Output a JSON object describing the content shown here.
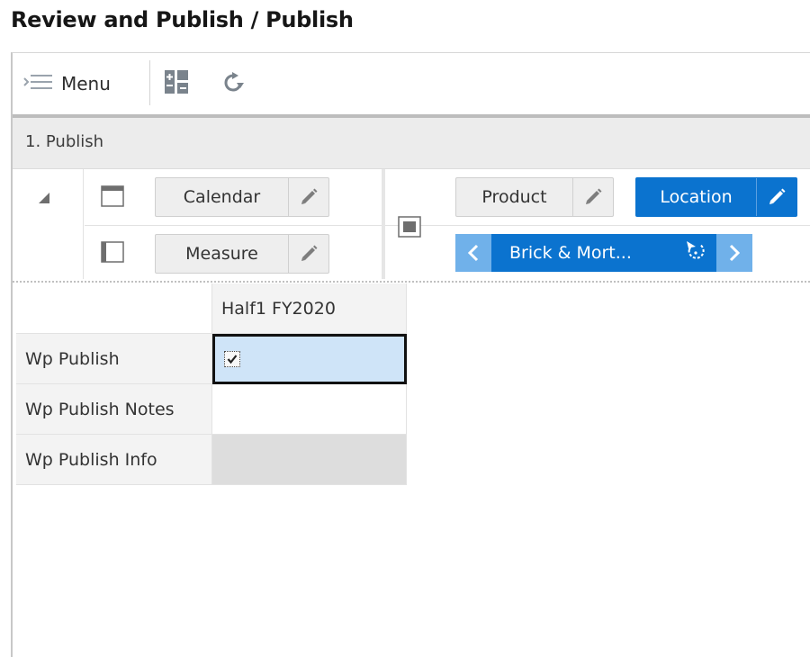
{
  "page": {
    "title": "Review and Publish / Publish"
  },
  "toolbar": {
    "menu_label": "Menu",
    "icons": [
      "menu-lines-icon",
      "pivot-layout-icon",
      "refresh-icon"
    ]
  },
  "step": {
    "label": "1. Publish"
  },
  "pivot": {
    "row_dims": [
      {
        "label": "Calendar"
      },
      {
        "label": "Measure"
      }
    ],
    "col_dims": [
      {
        "label": "Product"
      },
      {
        "label": "Location"
      }
    ],
    "page_dim": {
      "label": "Brick & Mort..."
    }
  },
  "grid": {
    "column_header": "Half1 FY2020",
    "rows": [
      {
        "label": "Wp Publish",
        "value": "checked"
      },
      {
        "label": "Wp Publish Notes",
        "value": ""
      },
      {
        "label": "Wp Publish Info",
        "value": ""
      }
    ]
  },
  "colors": {
    "accent": "#0b73cf",
    "accent_light": "#70b1ea",
    "selected_cell": "#cfe4f8",
    "readonly_cell": "#dddddd"
  }
}
